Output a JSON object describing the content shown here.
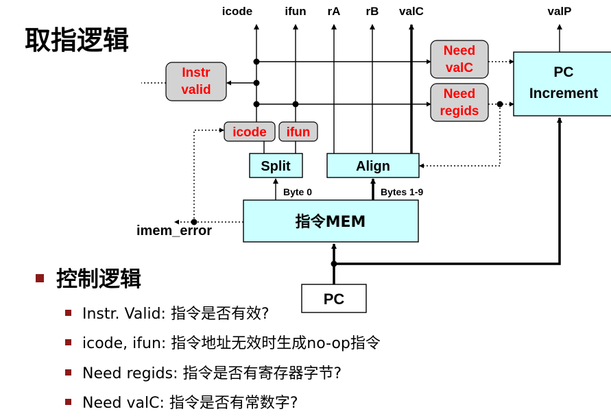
{
  "title": "取指逻辑",
  "outputs": {
    "icode": "icode",
    "ifun": "ifun",
    "ra": "rA",
    "rb": "rB",
    "valc": "valC",
    "valp": "valP"
  },
  "blocks": {
    "instr_valid": [
      "Instr",
      "valid"
    ],
    "need_valc": [
      "Need",
      "valC"
    ],
    "need_regids": [
      "Need",
      "regids"
    ],
    "icode_small": "icode",
    "ifun_small": "ifun",
    "split": "Split",
    "align": "Align",
    "pc_increment": [
      "PC",
      "Increment"
    ],
    "imem": "指令MEM",
    "pc": "PC"
  },
  "labels": {
    "byte0": "Byte 0",
    "bytes19": "Bytes 1-9",
    "imem_error": "imem_error"
  },
  "bullets": {
    "heading": "控制逻辑",
    "items": [
      "Instr. Valid: 指令是否有效?",
      "icode, ifun: 指令地址无效时生成no-op指令",
      "Need regids: 指令是否有寄存器字节?",
      "Need valC: 指令是否有常数字?"
    ]
  },
  "colors": {
    "block_fill": "#ccffff",
    "control_fill": "#d3d3d3",
    "control_text": "#ff0000",
    "bullet": "#8b1a1a"
  }
}
